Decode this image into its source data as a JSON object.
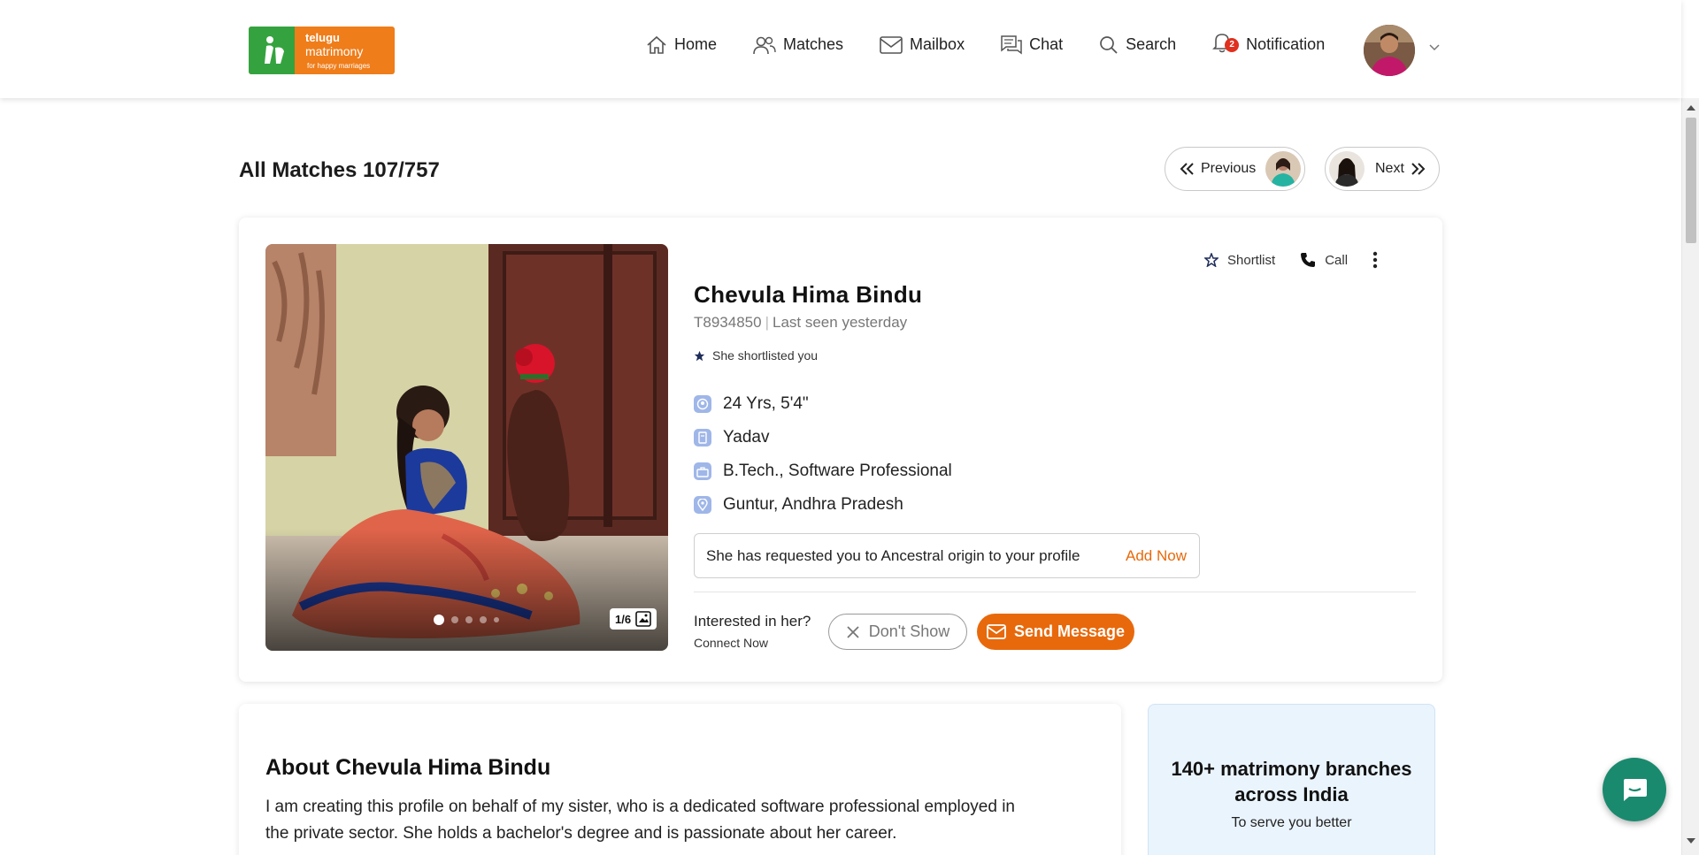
{
  "header": {
    "logo": {
      "line1": "telugu",
      "line2": "matrimony",
      "tagline": "for happy marriages"
    },
    "nav": [
      {
        "label": "Home",
        "icon": "home-icon"
      },
      {
        "label": "Matches",
        "icon": "users-icon"
      },
      {
        "label": "Mailbox",
        "icon": "mail-icon"
      },
      {
        "label": "Chat",
        "icon": "chat-icon"
      },
      {
        "label": "Search",
        "icon": "search-icon"
      },
      {
        "label": "Notification",
        "icon": "bell-icon",
        "badge": "2"
      }
    ]
  },
  "page": {
    "title": "All Matches 107/757",
    "prev_label": "Previous",
    "next_label": "Next"
  },
  "profile": {
    "name": "Chevula Hima Bindu",
    "id": "T8934850",
    "last_seen": "Last seen yesterday",
    "shortlisted_note": "She shortlisted you",
    "photo_counter": "1/6",
    "facts": [
      {
        "icon": "age-icon",
        "text": "24 Yrs, 5'4\""
      },
      {
        "icon": "caste-icon",
        "text": "Yadav"
      },
      {
        "icon": "education-icon",
        "text": "B.Tech., Software Professional"
      },
      {
        "icon": "location-icon",
        "text": "Guntur, Andhra Pradesh"
      }
    ],
    "request_text": "She has requested you to Ancestral origin to your profile",
    "request_action": "Add Now",
    "actions": {
      "shortlist": "Shortlist",
      "call": "Call"
    },
    "interest_question": "Interested in her?",
    "interest_sub": "Connect Now",
    "dont_show": "Don't Show",
    "send_message": "Send Message"
  },
  "about": {
    "title": "About Chevula Hima Bindu",
    "body": "I am creating this profile on behalf of my sister, who is a dedicated software professional employed in the private sector. She holds a bachelor's degree and is passionate about her career."
  },
  "branches": {
    "title": "140+ matrimony branches across India",
    "subtitle": "To serve you better"
  },
  "colors": {
    "accent": "#e8690b",
    "brand_orange": "#ef7d1a",
    "brand_green": "#34a33f",
    "chat_fab": "#1a8a6e"
  }
}
